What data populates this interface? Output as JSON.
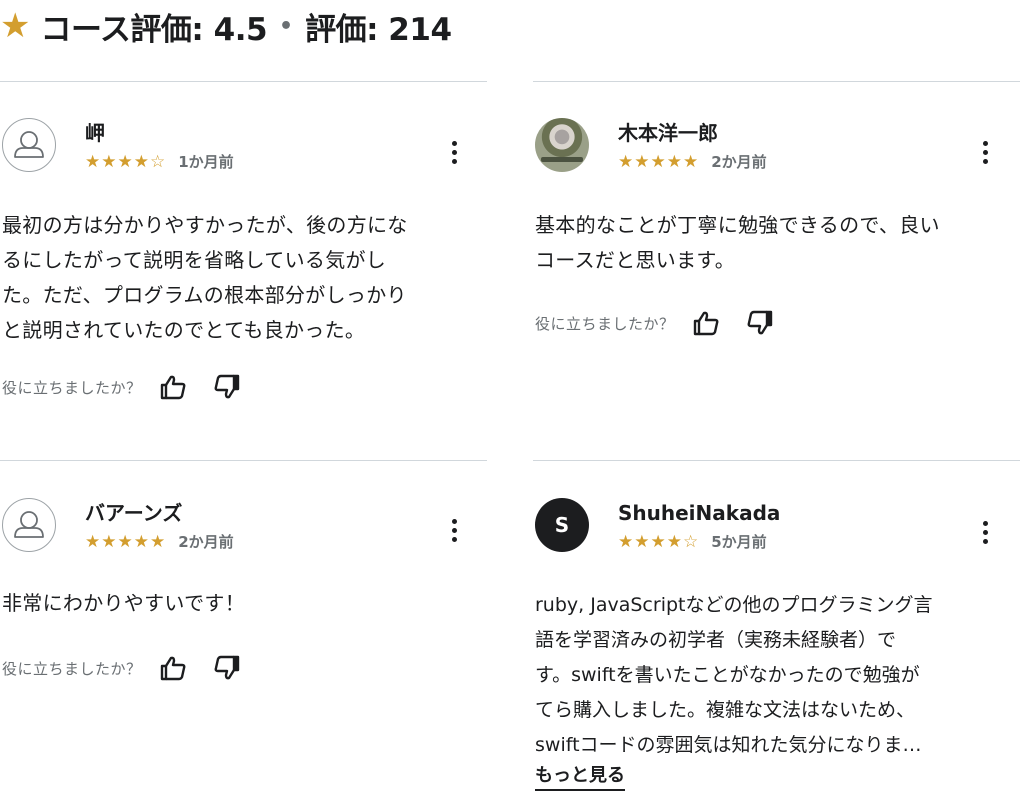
{
  "header": {
    "star_icon": "star-icon",
    "rating_label": "コース評価: 4.5",
    "separator": "•",
    "count_label": "評価: 214"
  },
  "reviews": [
    {
      "name": "岬",
      "avatar": "default-user-icon",
      "stars": "★★★★☆",
      "rating": 4,
      "date": "1か月前",
      "body": "最初の方は分かりやすかったが、後の方にな\nるにしたがって説明を省略している気がし\nた。ただ、プログラムの根本部分がしっかり\nと説明されていたのでとても良かった。",
      "helpful": "役に立ちましたか？"
    },
    {
      "name": "木本洋一郎",
      "avatar": "user-photo",
      "stars": "★★★★★",
      "rating": 5,
      "date": "2か月前",
      "body": "基本的なことが丁寧に勉強できるので、良い\nコースだと思います。",
      "helpful": "役に立ちましたか？"
    },
    {
      "name": "バアーンズ",
      "avatar": "default-user-icon",
      "stars": "★★★★★",
      "rating": 5,
      "date": "2か月前",
      "body": "非常にわかりやすいです！",
      "helpful": "役に立ちましたか？"
    },
    {
      "name": "ShuheiNakada",
      "avatar_letter": "S",
      "stars": "★★★★☆",
      "rating": 4,
      "date": "5か月前",
      "body": "ruby, JavaScriptなどの他のプログラミング言\n語を学習済みの初学者（実務未経験者）で\nす。swiftを書いたことがなかったので勉強が\nてら購入しました。複雑な文法はないため、\nswiftコードの雰囲気は知れた気分になりま…",
      "more": "もっと見る"
    }
  ],
  "colors": {
    "star": "#d39e2f",
    "text": "#1c1d1f",
    "muted": "#6a6f73",
    "divider": "#d1d7dc"
  }
}
